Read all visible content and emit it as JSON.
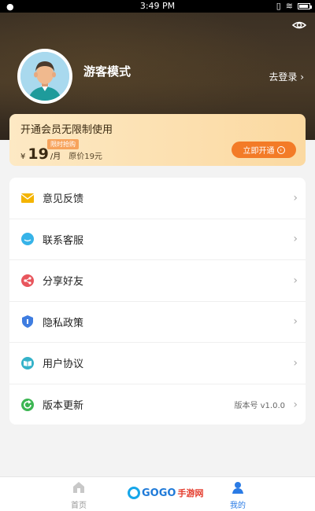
{
  "status_bar": {
    "time": "3:49 PM"
  },
  "profile": {
    "username": "游客模式",
    "login_link": "去登录 ›",
    "visibility_icon": "eye-icon"
  },
  "vip": {
    "title": "开通会员无限制使用",
    "badge": "限时抢购",
    "currency": "¥",
    "price": "19",
    "per": "/月",
    "original": "原价19元",
    "button_label": "立即开通",
    "colors": {
      "card": "#fde9c4",
      "button": "#f37b27"
    }
  },
  "menu": {
    "items": [
      {
        "label": "意见反馈",
        "icon": "mail-icon",
        "color": "#f4b400"
      },
      {
        "label": "联系客服",
        "icon": "chat-icon",
        "color": "#36b3e8"
      },
      {
        "label": "分享好友",
        "icon": "share-icon",
        "color": "#e8565d"
      },
      {
        "label": "隐私政策",
        "icon": "shield-icon",
        "color": "#3f7de0"
      },
      {
        "label": "用户协议",
        "icon": "book-icon",
        "color": "#35b2c9"
      },
      {
        "label": "版本更新",
        "icon": "refresh-icon",
        "color": "#3cb652",
        "extra": "版本号 v1.0.0"
      }
    ],
    "chevron": "›"
  },
  "tabs": [
    {
      "label": "首页",
      "icon": "home-icon",
      "active": false
    },
    {
      "label": "我的",
      "icon": "user-icon",
      "active": true
    }
  ],
  "watermark": {
    "text": "GOGO",
    "tail": "手游网"
  }
}
